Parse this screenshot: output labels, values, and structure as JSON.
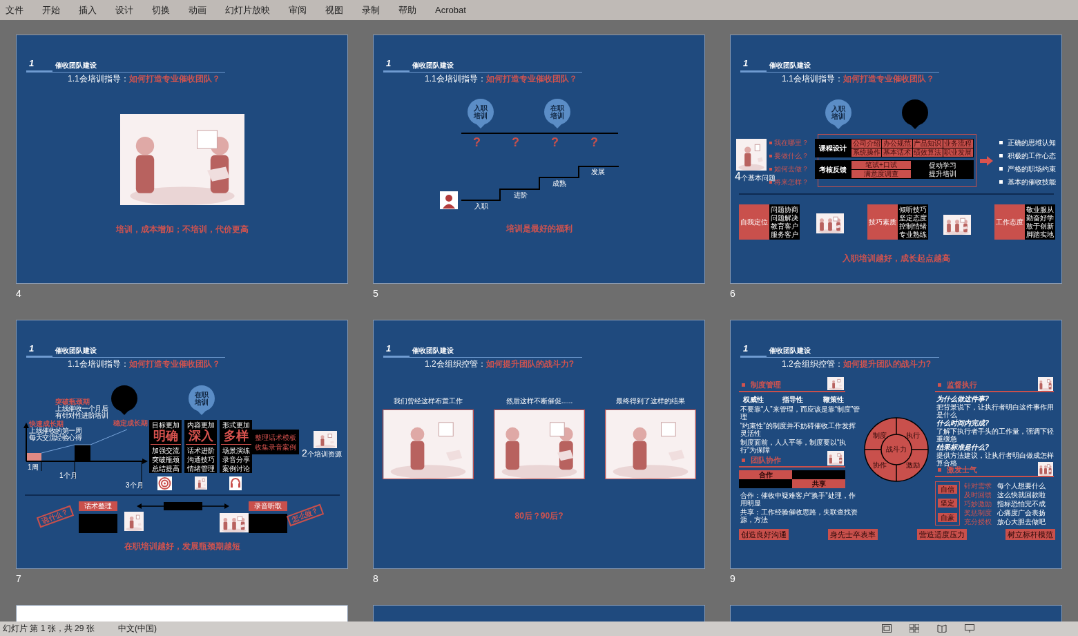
{
  "menu": [
    "文件",
    "开始",
    "插入",
    "设计",
    "切换",
    "动画",
    "幻灯片放映",
    "审阅",
    "视图",
    "录制",
    "帮助",
    "Acrobat"
  ],
  "slides": [
    {
      "number": "4",
      "kind": "picture",
      "header": {
        "section_no": "1",
        "section": "催收团队建设",
        "lead": "1.1会培训指导：",
        "question": "如何打造专业催收团队？"
      },
      "footer": "培训，成本增加；不培训，代价更高"
    },
    {
      "number": "5",
      "kind": "stairs",
      "header": {
        "section_no": "1",
        "section": "催收团队建设",
        "lead": "1.1会培训指导：",
        "question": "如何打造专业催收团队？"
      },
      "pins": [
        "入职培训",
        "在职培训"
      ],
      "marks": [
        "?",
        "?",
        "?",
        "?"
      ],
      "steps": [
        "入职",
        "进阶",
        "成熟",
        "发展"
      ],
      "footer": "培训是最好的福利"
    },
    {
      "number": "6",
      "kind": "onboarding",
      "header": {
        "section_no": "1",
        "section": "催收团队建设",
        "lead": "1.1会培训指导：",
        "question": "如何打造专业催收团队？"
      },
      "pin": "入职培训",
      "count": "4",
      "count_label": "个基本问题",
      "questions": [
        "我在哪里？",
        "要做什么？",
        "如何去做？",
        "将来怎样？"
      ],
      "course": {
        "label": "课程设计",
        "cells": [
          "公司介绍",
          "办公规范",
          "产品知识",
          "业务流程",
          "系统操作",
          "基本话术",
          "绩效算法",
          "职业发展"
        ]
      },
      "review": {
        "label": "考核反馈",
        "cells": [
          "笔试+口试",
          "满意度调查"
        ],
        "notes": [
          "促动学习",
          "提升培训"
        ]
      },
      "goals": [
        "正确的思维认知",
        "积极的工作心态",
        "严格的职场约束",
        "基本的催收技能"
      ],
      "groups": [
        {
          "label": "自我定位",
          "items": [
            "问题协商",
            "问题解决",
            "教育客户",
            "服务客户"
          ]
        },
        {
          "label": "技巧素质",
          "items": [
            "倾听技巧",
            "坚定态度",
            "控制情绪",
            "专业熟练"
          ]
        },
        {
          "label": "工作态度",
          "items": [
            "敬业服从",
            "勤奋好学",
            "敢于创新",
            "脚踏实地"
          ]
        }
      ],
      "footer": "入职培训越好，成长起点越高"
    },
    {
      "number": "7",
      "kind": "onjob",
      "header": {
        "section_no": "1",
        "section": "催收团队建设",
        "lead": "1.1会培训指导：",
        "question": "如何打造专业催收团队？"
      },
      "pin": "在职培训",
      "phases": [
        {
          "title": "快速成长期",
          "lines": [
            "上线催收的第一周",
            "每天交流经验心得"
          ]
        },
        {
          "title": "突破瓶颈期",
          "lines": [
            "上线催收一个月后",
            "有针对性进阶培训"
          ]
        },
        {
          "title": "稳定成长期"
        }
      ],
      "ticks": [
        "1周",
        "1个月",
        "3个月"
      ],
      "columns": [
        {
          "head": "目标更加",
          "big": "明确",
          "items": [
            "加强交流",
            "突破瓶颈",
            "总结提高"
          ]
        },
        {
          "head": "内容更加",
          "big": "深入",
          "items": [
            "话术进阶",
            "沟通技巧",
            "情绪管理"
          ]
        },
        {
          "head": "形式更加",
          "big": "多样",
          "items": [
            "场景演练",
            "录音分享",
            "案例讨论"
          ]
        }
      ],
      "resources": [
        "整理话术模板",
        "收集录音案例"
      ],
      "resource_count": "2",
      "resource_label": "个培训资源",
      "tags": [
        "话术整理",
        "录音听取"
      ],
      "stamps": [
        "说什么？",
        "怎么做？"
      ],
      "footer": "在职培训越好，发展瓶颈期越短"
    },
    {
      "number": "8",
      "kind": "comics",
      "header": {
        "section_no": "1",
        "section": "催收团队建设",
        "lead": "1.2会组织控管：",
        "question": "如何提升团队的战斗力?"
      },
      "panels": [
        "我们曾经这样布置工作",
        "然后这样不断催促......",
        "最终得到了这样的结果"
      ],
      "footer": "80后？90后?"
    },
    {
      "number": "9",
      "kind": "management",
      "header": {
        "section_no": "1",
        "section": "催收团队建设",
        "lead": "1.2会组织控管：",
        "question": "如何提升团队的战斗力?"
      },
      "rules": {
        "heading": "制度管理",
        "traits": [
          "权威性",
          "指导性",
          "鞭策性"
        ],
        "lines": [
          "不要靠“人”来管理，而应该是靠“制度”管理",
          "“约束性”的制度并不妨碍催收工作发挥灵活性",
          "制度面前，人人平等，制度要以“执行”为保障"
        ]
      },
      "team": {
        "heading": "团队协作",
        "bars": [
          "合作",
          "共享"
        ],
        "lines": [
          "合作：催收中疑难客户“换手”处理，作用明显",
          "共享：工作经验催收思路，失联查找资源，方法"
        ]
      },
      "wheel": {
        "center": "战斗力",
        "parts": [
          "制度",
          "执行",
          "协作",
          "激励"
        ]
      },
      "supervise": {
        "heading": "监督执行",
        "items": [
          {
            "q": "为什么做这件事?",
            "a": "把背景说下，让执行者明白这件事作用是什么"
          },
          {
            "q": "什么时间内完成?",
            "a": "了解下执行者手头的工作量，强调下轻重缓急"
          },
          {
            "q": "结果标准是什么?",
            "a": "提供方法建议，让执行者明白做成怎样算合格"
          }
        ]
      },
      "morale": {
        "heading": "激发士气",
        "badges": [
          "自信",
          "坚定",
          "自豪"
        ],
        "methods": [
          "针对需求",
          "及时回馈",
          "巧妙激励",
          "奖惩制度",
          "充分授权"
        ],
        "phrases": [
          "每个人想要什么",
          "这么快就回款啦",
          "指标恐怕完不成",
          "心痛度广会表扬",
          "放心大胆去做吧"
        ]
      },
      "actions": [
        "创造良好沟通",
        "身先士卒表率",
        "营造适度压力",
        "树立标杆模范"
      ]
    },
    {
      "kind": "blank",
      "light": true
    },
    {
      "kind": "blank",
      "light": false
    },
    {
      "kind": "blank",
      "light": false
    }
  ],
  "status": {
    "slide_info": "幻灯片 第 1 张，共 29 张",
    "language": "中文(中国)"
  }
}
